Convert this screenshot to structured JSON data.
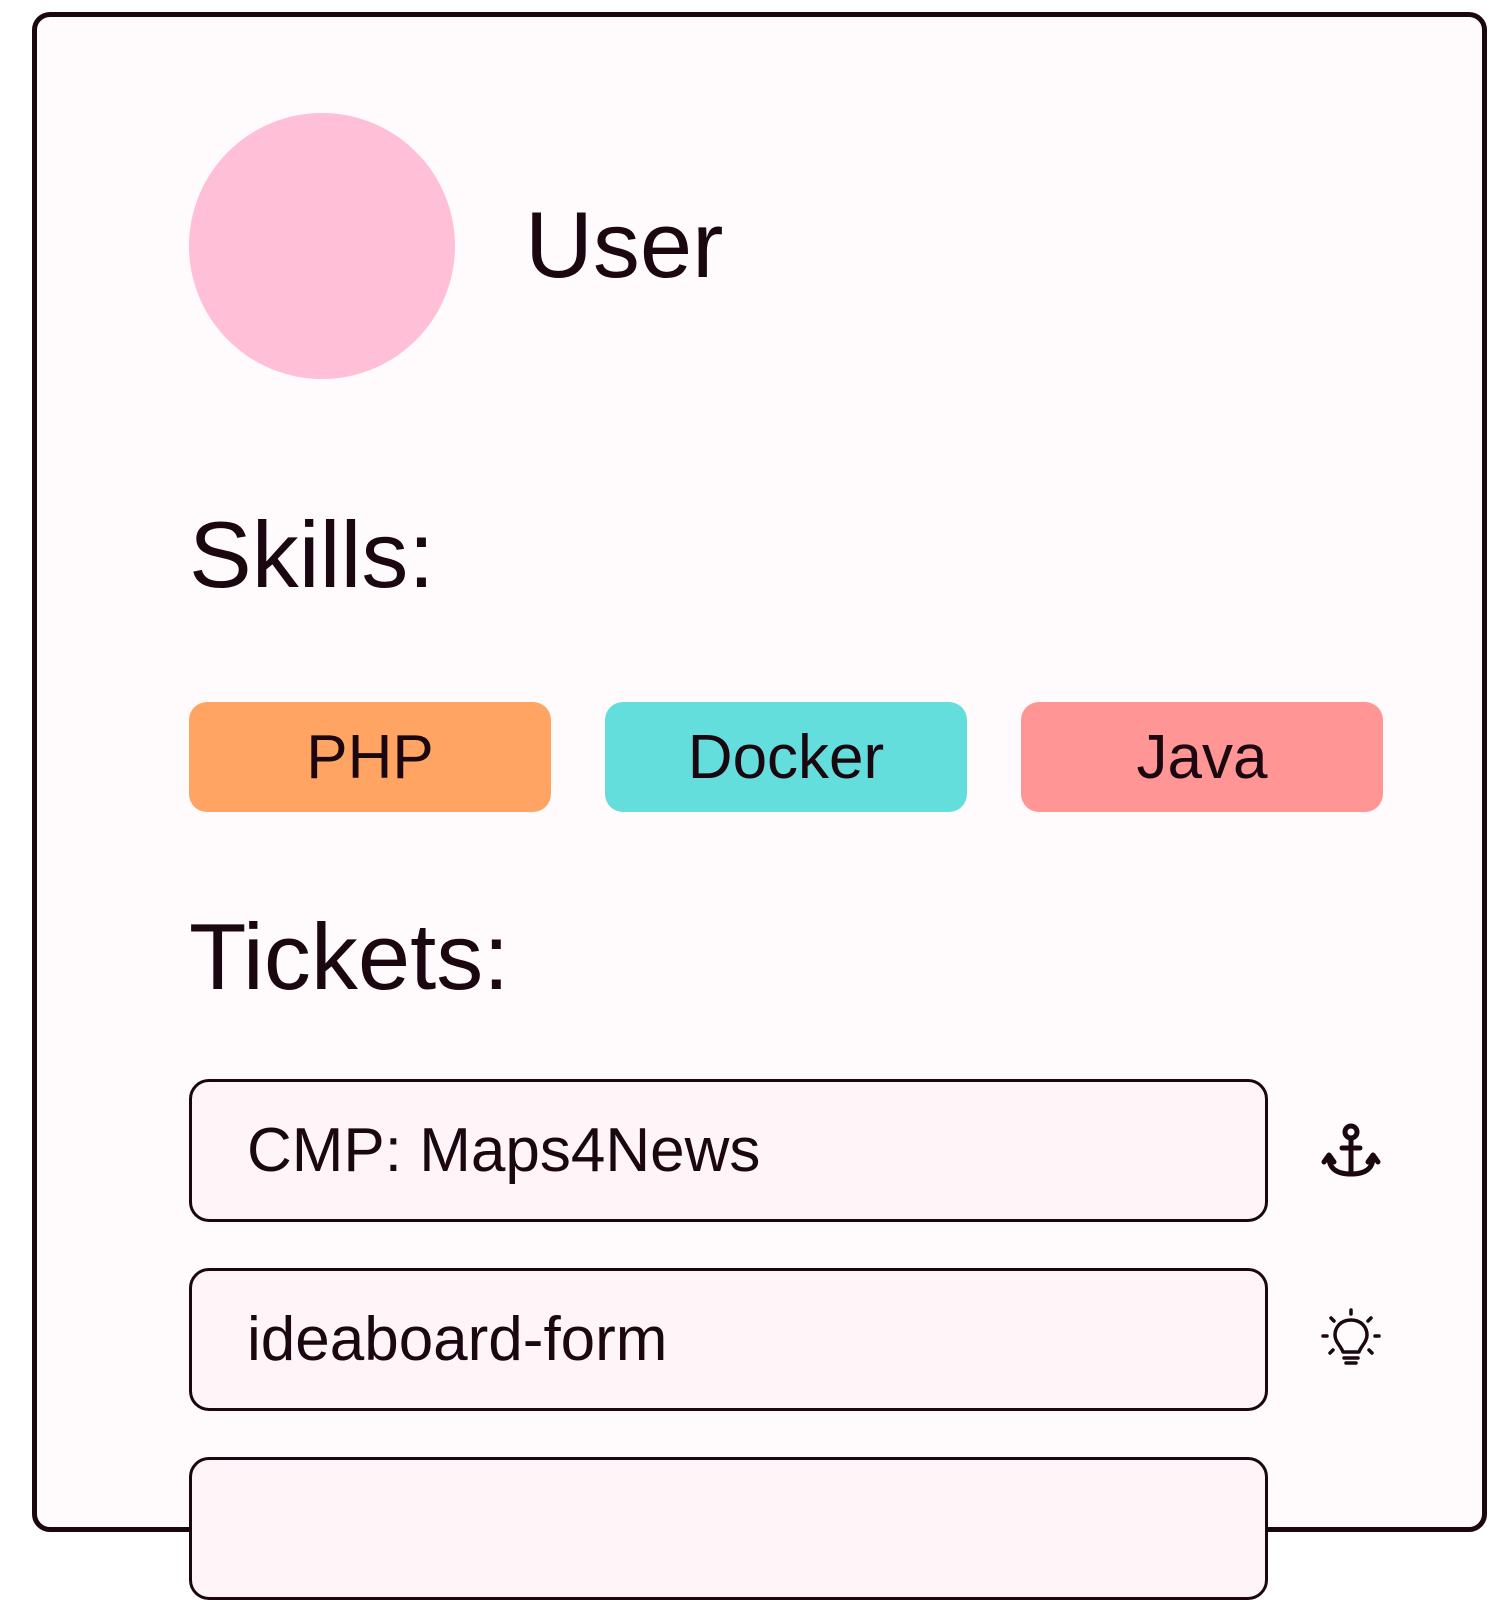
{
  "user": {
    "name": "User",
    "avatar_color": "#ffbfd6"
  },
  "skills": {
    "title": "Skills:",
    "items": [
      {
        "label": "PHP",
        "color": "#ffa462"
      },
      {
        "label": "Docker",
        "color": "#64dedc"
      },
      {
        "label": "Java",
        "color": "#ff9595"
      }
    ]
  },
  "tickets": {
    "title": "Tickets:",
    "items": [
      {
        "label": "CMP: Maps4News",
        "icon": "anchor-icon"
      },
      {
        "label": "ideaboard-form",
        "icon": "lightbulb-icon"
      },
      {
        "label": "",
        "icon": ""
      }
    ]
  }
}
